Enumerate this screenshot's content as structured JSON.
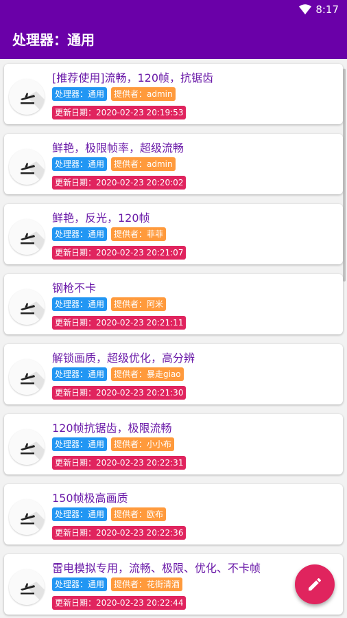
{
  "status_bar": {
    "time": "8:17"
  },
  "app_bar": {
    "title": "处理器：通用"
  },
  "items": [
    {
      "title": "[推荐使用]流畅，120帧，抗锯齿",
      "cpu": "处理器：通用",
      "provider": "提供者：admin",
      "date": "更新日期：2020-02-23 20:19:53"
    },
    {
      "title": "鲜艳，极限帧率，超级流畅",
      "cpu": "处理器：通用",
      "provider": "提供者：admin",
      "date": "更新日期：2020-02-23 20:20:02"
    },
    {
      "title": "鲜艳，反光，120帧",
      "cpu": "处理器：通用",
      "provider": "提供者：菲菲",
      "date": "更新日期：2020-02-23 20:21:07"
    },
    {
      "title": "钢枪不卡",
      "cpu": "处理器：通用",
      "provider": "提供者：阿米",
      "date": "更新日期：2020-02-23 20:21:11"
    },
    {
      "title": "解锁画质，超级优化，高分辨",
      "cpu": "处理器：通用",
      "provider": "提供者：暴走giao",
      "date": "更新日期：2020-02-23 20:21:30"
    },
    {
      "title": "120帧抗锯齿，极限流畅",
      "cpu": "处理器：通用",
      "provider": "提供者：小小布",
      "date": "更新日期：2020-02-23 20:22:31"
    },
    {
      "title": "150帧极高画质",
      "cpu": "处理器：通用",
      "provider": "提供者：欧布",
      "date": "更新日期：2020-02-23 20:22:36"
    },
    {
      "title": "雷电模拟专用，流畅、极限、优化、不卡帧",
      "cpu": "处理器：通用",
      "provider": "提供者：花街清酒",
      "date": "更新日期：2020-02-23 20:22:44"
    }
  ],
  "icons": {
    "item_icon": "airplane-takeoff-icon",
    "fab_icon": "pencil-icon",
    "status_icon": "wifi-icon"
  },
  "colors": {
    "primary": "#6a00a8",
    "cpu_tag": "#2196f3",
    "provider_tag": "#ff9a3c",
    "date_tag": "#e0245e",
    "fab": "#e0245e"
  }
}
